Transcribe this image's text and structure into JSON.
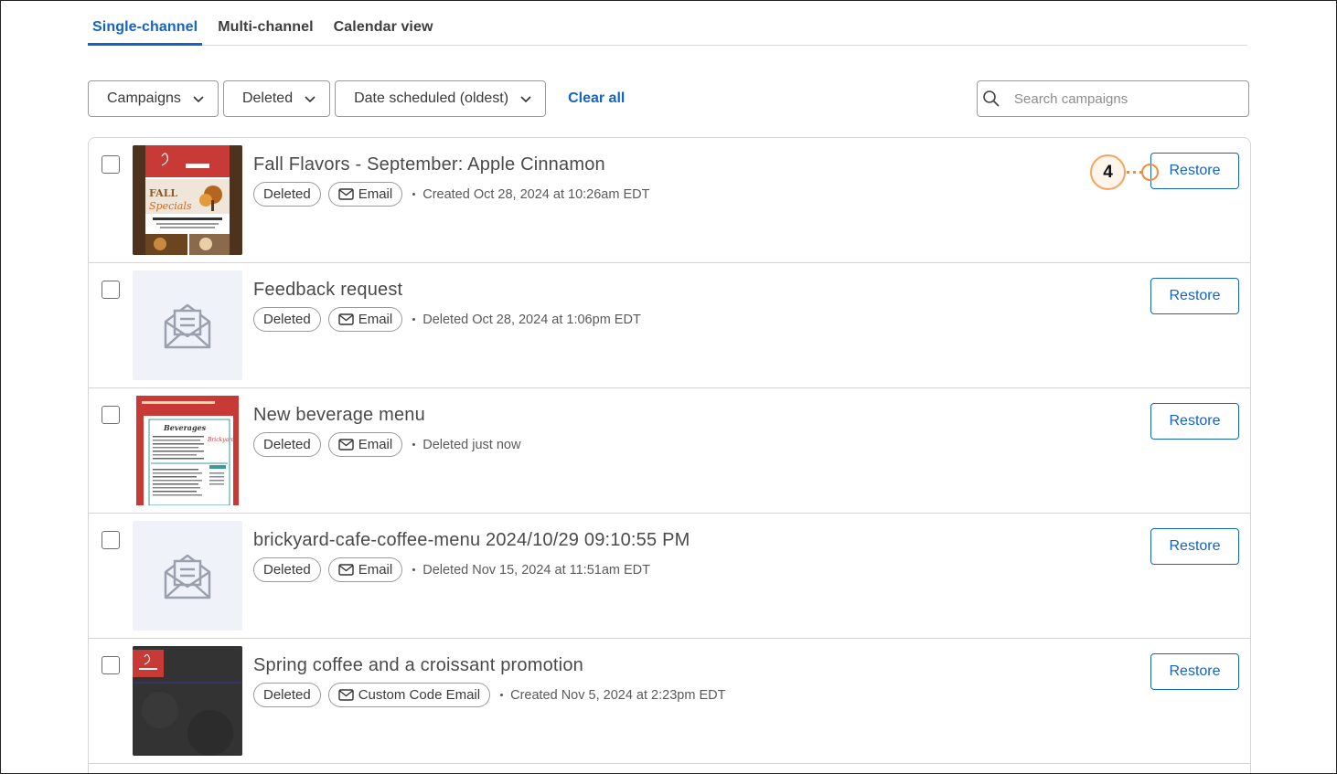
{
  "tabs": [
    {
      "label": "Single-channel",
      "active": true
    },
    {
      "label": "Multi-channel",
      "active": false
    },
    {
      "label": "Calendar view",
      "active": false
    }
  ],
  "filters": {
    "campaigns": "Campaigns",
    "status": "Deleted",
    "sort": "Date scheduled (oldest)",
    "clear_all": "Clear all"
  },
  "search": {
    "placeholder": "Search campaigns",
    "value": ""
  },
  "callout": {
    "number": "4"
  },
  "campaigns": [
    {
      "title": "Fall Flavors - September: Apple Cinnamon",
      "status": "Deleted",
      "type": "Email",
      "meta": "Created Oct 28, 2024 at 10:26am EDT",
      "thumb": "fall-specials-thumbnail",
      "restore": "Restore"
    },
    {
      "title": "Feedback request",
      "status": "Deleted",
      "type": "Email",
      "meta": "Deleted Oct 28, 2024 at 1:06pm EDT",
      "thumb": "envelope-placeholder-icon",
      "restore": "Restore"
    },
    {
      "title": "New beverage menu",
      "status": "Deleted",
      "type": "Email",
      "meta": "Deleted just now",
      "thumb": "beverage-menu-thumbnail",
      "restore": "Restore"
    },
    {
      "title": "brickyard-cafe-coffee-menu 2024/10/29 09:10:55 PM",
      "status": "Deleted",
      "type": "Email",
      "meta": "Deleted Nov 15, 2024 at 11:51am EDT",
      "thumb": "envelope-placeholder-icon",
      "restore": "Restore"
    },
    {
      "title": "Spring coffee and a croissant promotion",
      "status": "Deleted",
      "type": "Custom Code Email",
      "meta": "Created Nov 5, 2024 at 2:23pm EDT",
      "thumb": "chalkboard-thumbnail",
      "restore": "Restore"
    }
  ],
  "colors": {
    "accent": "#1464c3",
    "callout": "#f08c3a",
    "placeholder_bg": "#eff2f9"
  }
}
